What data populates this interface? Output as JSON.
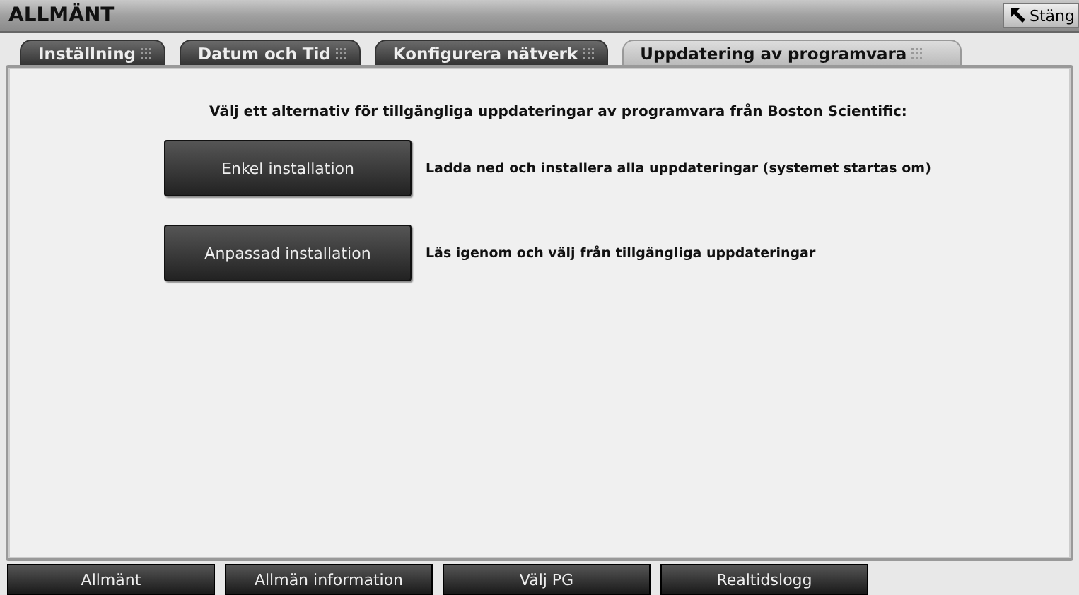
{
  "window": {
    "title": "ALLMÄNT",
    "close_button": "Stäng"
  },
  "tabs": [
    {
      "label": "Inställning",
      "selected": false
    },
    {
      "label": "Datum och Tid",
      "selected": false
    },
    {
      "label": "Konfigurera nätverk",
      "selected": false
    },
    {
      "label": "Uppdatering av programvara",
      "selected": true
    }
  ],
  "instruction": "Välj ett alternativ för tillgängliga uppdateringar av programvara från Boston Scientific:",
  "options": [
    {
      "button": "Enkel installation",
      "description": "Ladda ned och installera alla uppdateringar (systemet startas om)"
    },
    {
      "button": "Anpassad installation",
      "description": "Läs igenom och välj från tillgängliga uppdateringar"
    }
  ],
  "bottom_nav": [
    "Allmänt",
    "Allmän information",
    "Välj PG",
    "Realtidslogg"
  ]
}
